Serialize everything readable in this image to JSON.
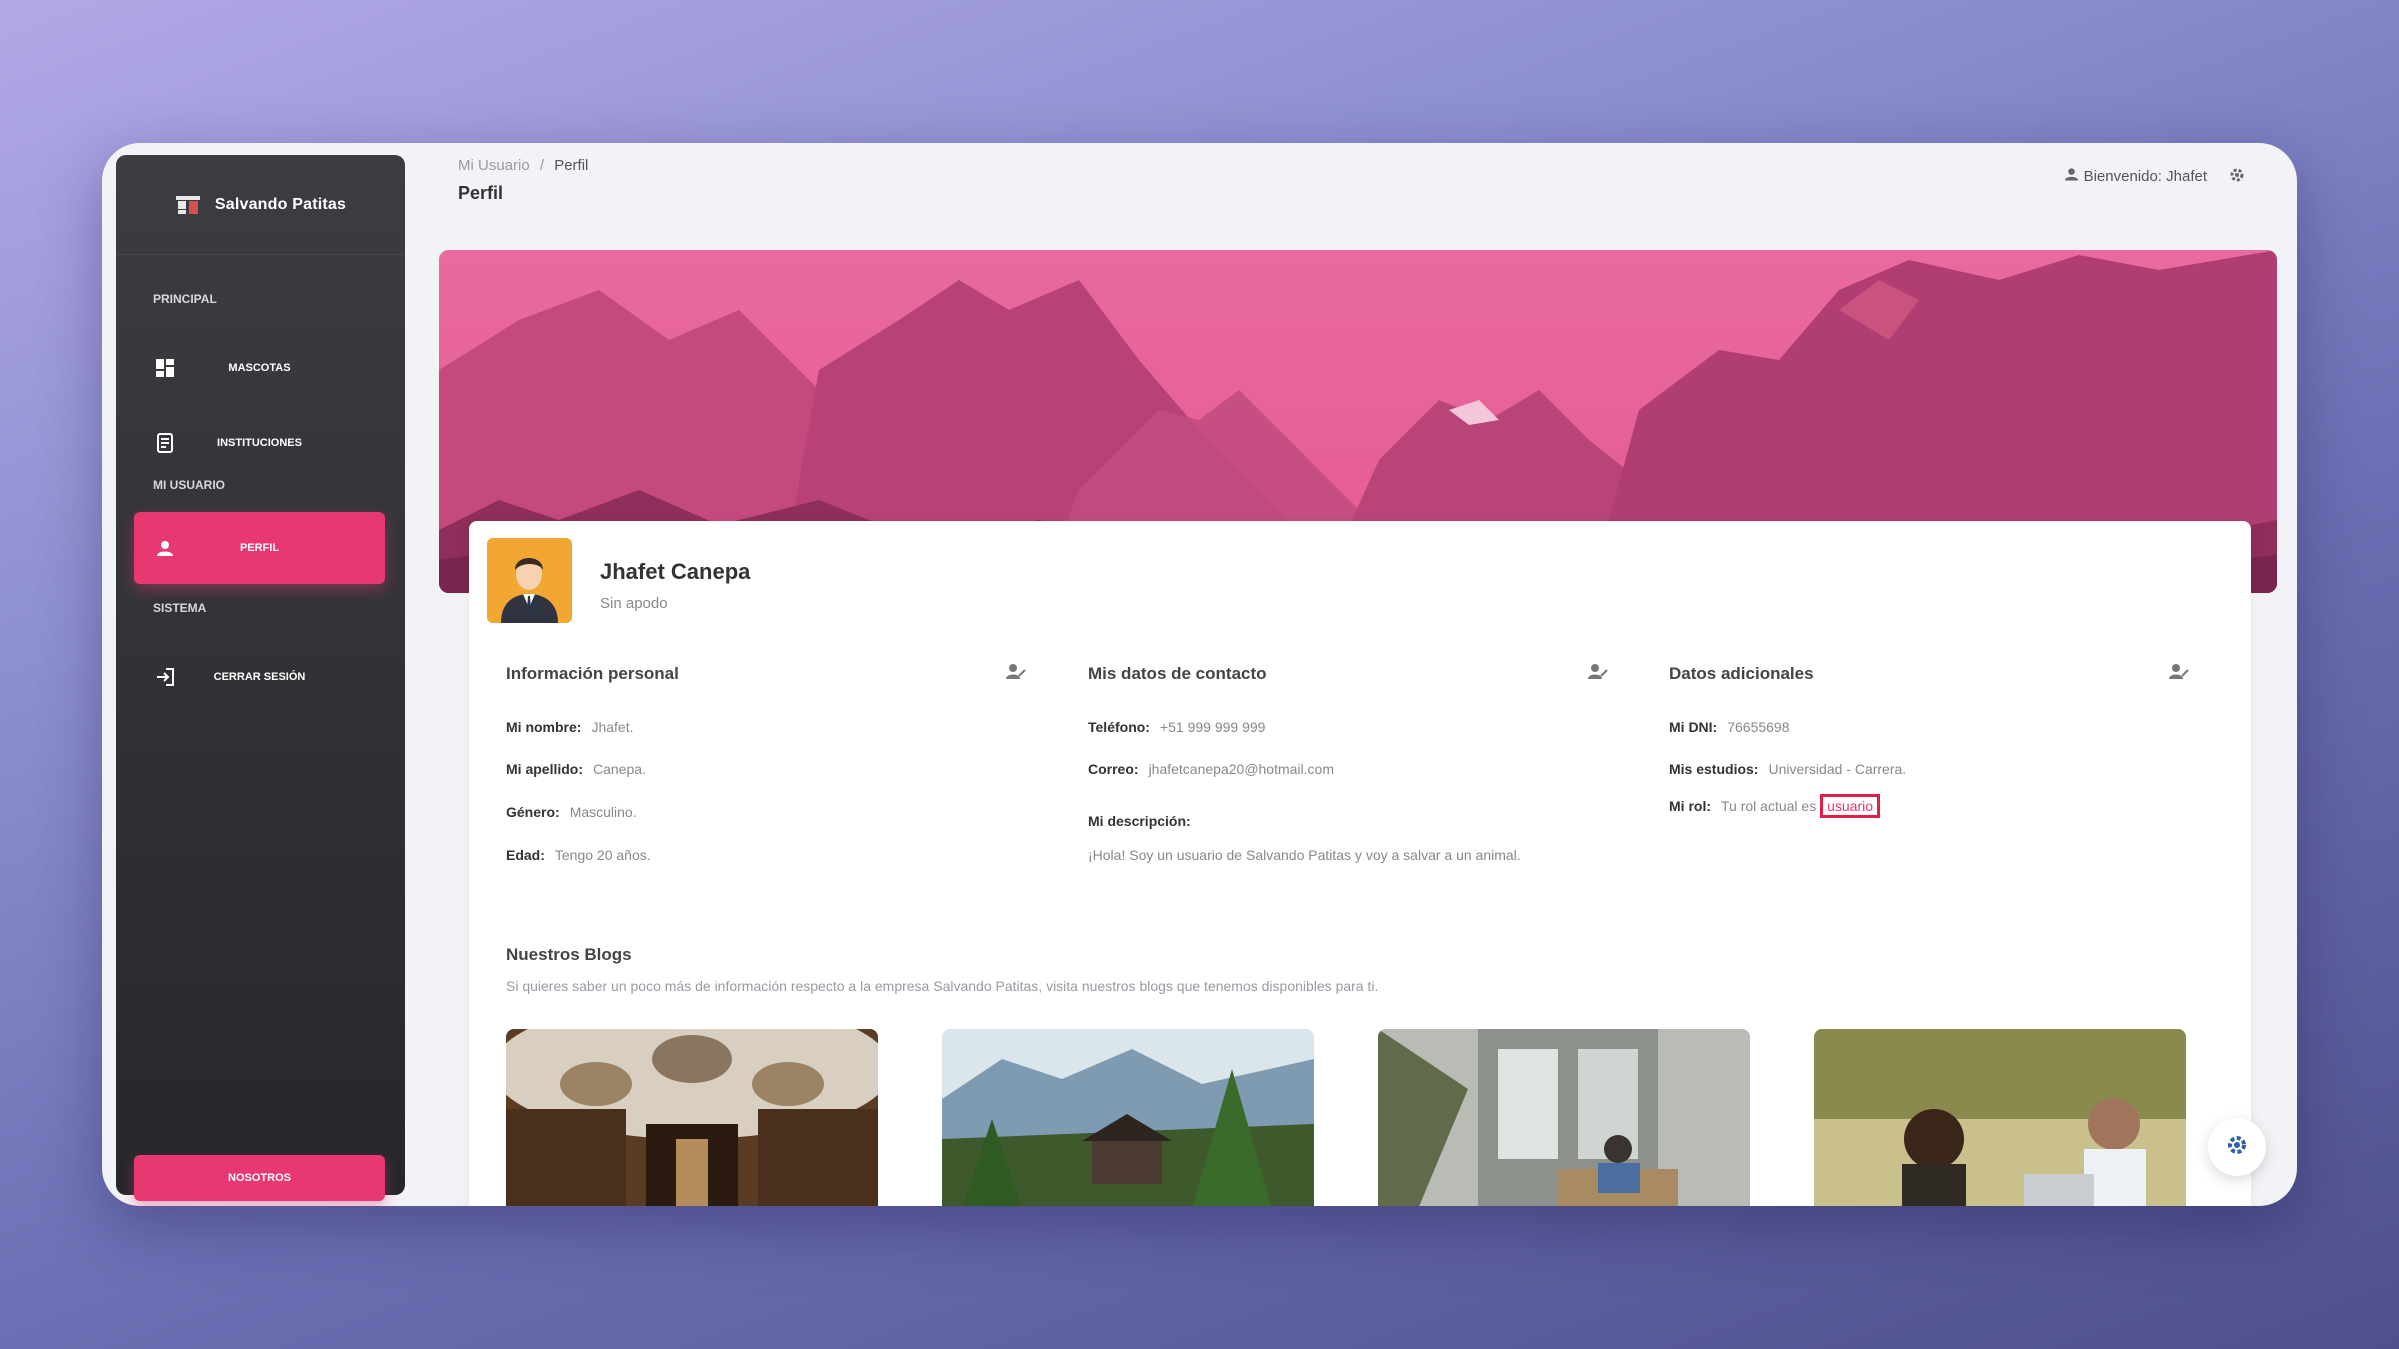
{
  "brand": {
    "name": "Salvando Patitas"
  },
  "sidebar": {
    "sections": [
      "PRINCIPAL",
      "MI USUARIO",
      "SISTEMA"
    ],
    "items": [
      {
        "label": "MASCOTAS",
        "icon": "dashboard-icon"
      },
      {
        "label": "INSTITUCIONES",
        "icon": "document-icon"
      },
      {
        "label": "PERFIL",
        "icon": "user-icon"
      },
      {
        "label": "CERRAR SESIÓN",
        "icon": "logout-icon"
      }
    ],
    "footer_button": "NOSOTROS"
  },
  "header": {
    "breadcrumb_parent": "Mi Usuario",
    "breadcrumb_sep": "/",
    "breadcrumb_current": "Perfil",
    "title": "Perfil",
    "welcome": "Bienvenido: Jhafet"
  },
  "profile": {
    "name": "Jhafet Canepa",
    "nickname": "Sin apodo"
  },
  "personal": {
    "title": "Información personal",
    "nombre_label": "Mi nombre:",
    "nombre": "Jhafet.",
    "apellido_label": "Mi apellido:",
    "apellido": "Canepa.",
    "genero_label": "Género:",
    "genero": "Masculino.",
    "edad_label": "Edad:",
    "edad": "Tengo 20 años."
  },
  "contact": {
    "title": "Mis datos de contacto",
    "telefono_label": "Teléfono:",
    "telefono": "+51 999 999 999",
    "correo_label": "Correo:",
    "correo": "jhafetcanepa20@hotmail.com",
    "descripcion_label": "Mi descripción:",
    "descripcion": "¡Hola! Soy un usuario de Salvando Patitas y voy a salvar a un animal."
  },
  "extra": {
    "title": "Datos adicionales",
    "dni_label": "Mi DNI:",
    "dni": "76655698",
    "estudios_label": "Mis estudios:",
    "estudios": "Universidad - Carrera.",
    "rol_label": "Mi rol:",
    "rol_text": "Tu rol actual es",
    "rol": "usuario"
  },
  "blogs": {
    "title": "Nuestros Blogs",
    "description": "Si quieres saber un poco más de información respecto a la empresa Salvando Patitas, visita nuestros blogs que tenemos disponibles para ti."
  },
  "colors": {
    "accent": "#e83872",
    "sidebar": "#2e2f33",
    "banner": "#e25b91"
  }
}
